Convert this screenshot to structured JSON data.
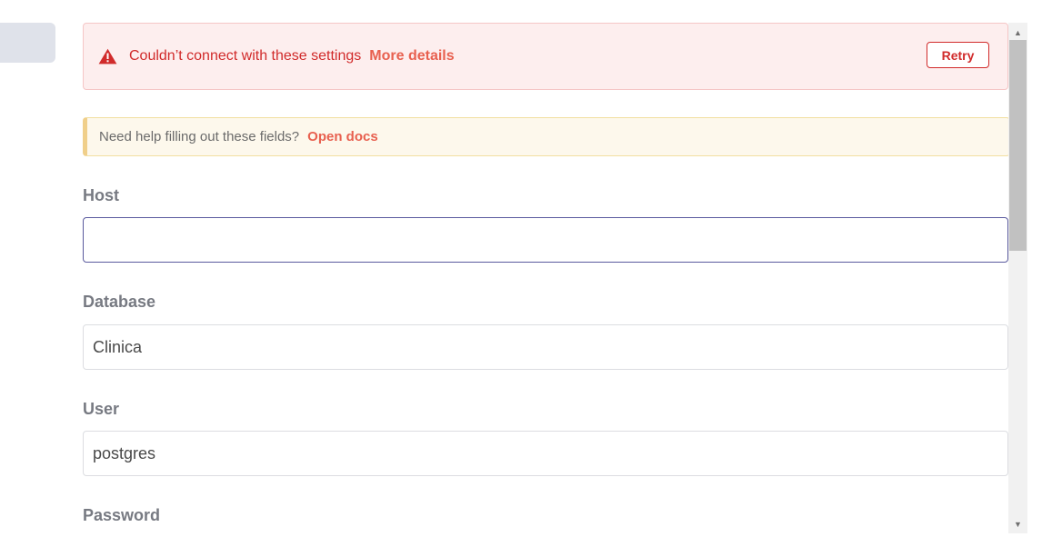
{
  "error_banner": {
    "icon": "warning-triangle-icon",
    "message": "Couldn’t connect with these settings",
    "details_link": "More details",
    "retry_label": "Retry"
  },
  "help_banner": {
    "text": "Need help filling out these fields?",
    "docs_link": "Open docs"
  },
  "fields": {
    "host": {
      "label": "Host",
      "value": ""
    },
    "database": {
      "label": "Database",
      "value": "Clinica"
    },
    "user": {
      "label": "User",
      "value": "postgres"
    },
    "password": {
      "label": "Password"
    }
  },
  "scrollbar": {
    "up_icon": "▲",
    "down_icon": "▼"
  },
  "colors": {
    "error": "#d12b2b",
    "link": "#e8604f",
    "focus_border": "#5a5a9e",
    "help_accent": "#f0cf8a"
  }
}
